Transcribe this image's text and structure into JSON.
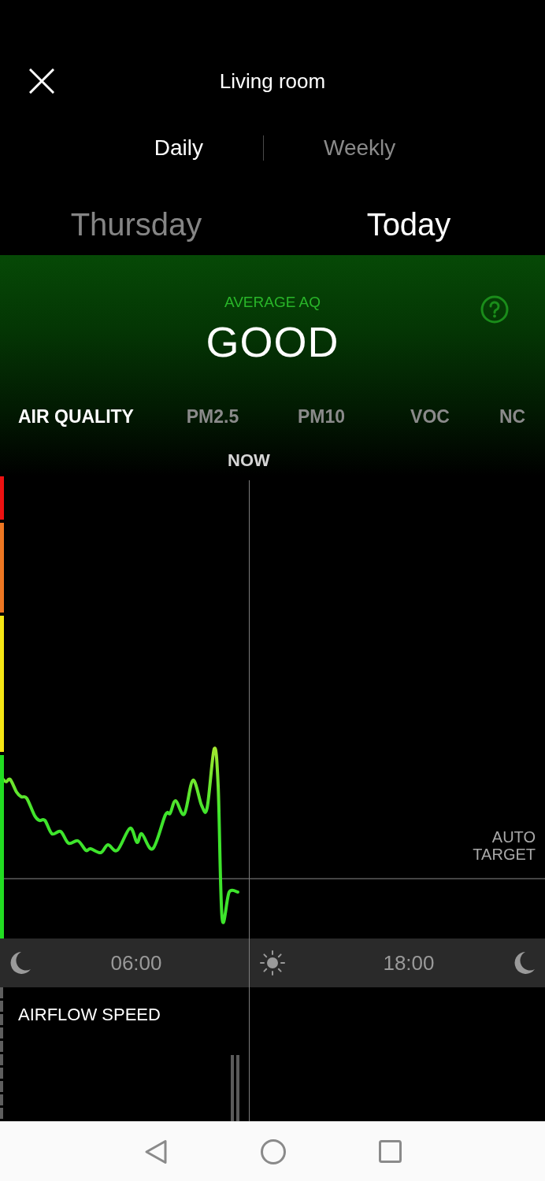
{
  "header": {
    "title": "Living room"
  },
  "periods": [
    {
      "label": "Daily",
      "selected": true
    },
    {
      "label": "Weekly",
      "selected": false
    }
  ],
  "days": [
    {
      "label": "Thursday",
      "selected": false
    },
    {
      "label": "Today",
      "selected": true
    }
  ],
  "summary": {
    "label": "AVERAGE AQ",
    "value": "GOOD"
  },
  "pollutant_tabs": [
    {
      "label": "AIR QUALITY",
      "selected": true
    },
    {
      "label": "PM2.5",
      "selected": false
    },
    {
      "label": "PM10",
      "selected": false
    },
    {
      "label": "VOC",
      "selected": false
    },
    {
      "label": "NC",
      "selected": false
    }
  ],
  "chart": {
    "now_label": "NOW",
    "target_label": "AUTO TARGET",
    "aq_scale": [
      {
        "color": "#ee1111"
      },
      {
        "color": "#ee7722"
      },
      {
        "color": "#f5e614"
      },
      {
        "color": "#22dd22"
      }
    ]
  },
  "timeline": {
    "times": [
      "06:00",
      "18:00"
    ]
  },
  "airflow": {
    "title": "AIRFLOW SPEED"
  }
}
